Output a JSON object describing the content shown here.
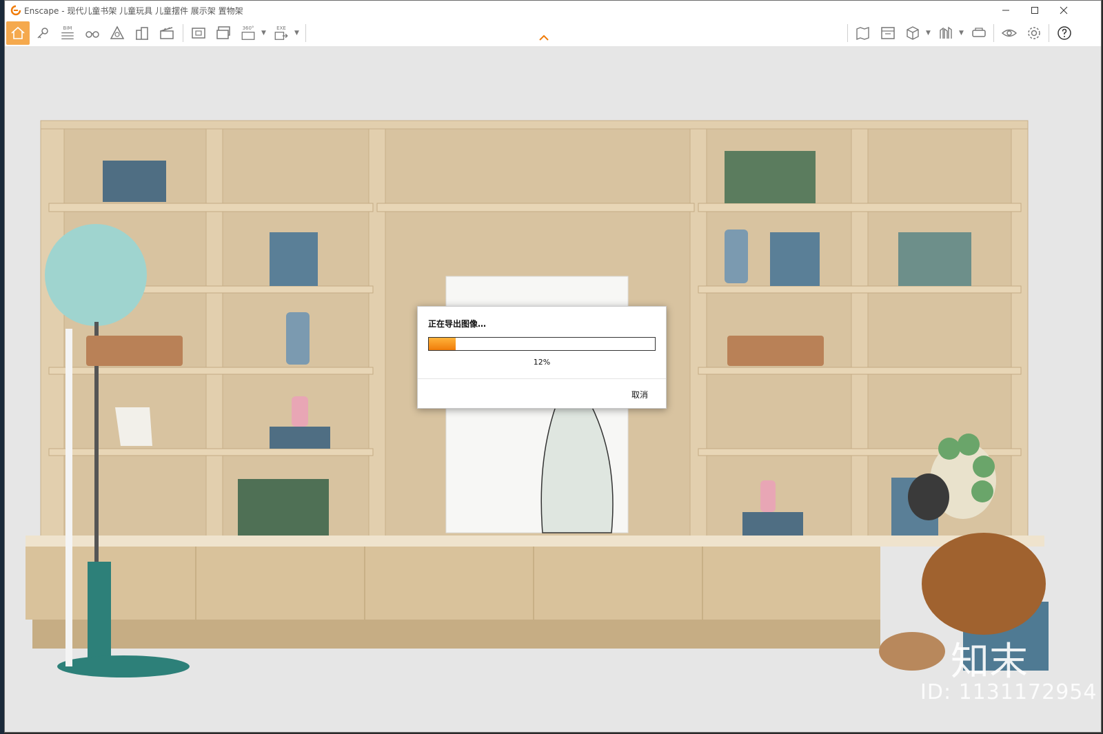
{
  "window": {
    "title": "Enscape - 现代儿童书架 儿童玩具 儿童摆件 展示架 置物架",
    "minimize_icon": "minimize-icon",
    "maximize_icon": "maximize-icon",
    "close_icon": "close-icon"
  },
  "toolbar": {
    "bim_label": "BIM",
    "pano_label": "360°",
    "exe_label": "EXE"
  },
  "dialog": {
    "title": "正在导出图像…",
    "progress": 0.12,
    "percent_label": "12%",
    "cancel_label": "取消"
  },
  "watermark": {
    "brand": "知末",
    "id_label": "ID: 1131172954"
  },
  "colors": {
    "accent": "#f5a94d",
    "progress": "#f07c0a",
    "shelf_wood": "#dcc8a6"
  }
}
